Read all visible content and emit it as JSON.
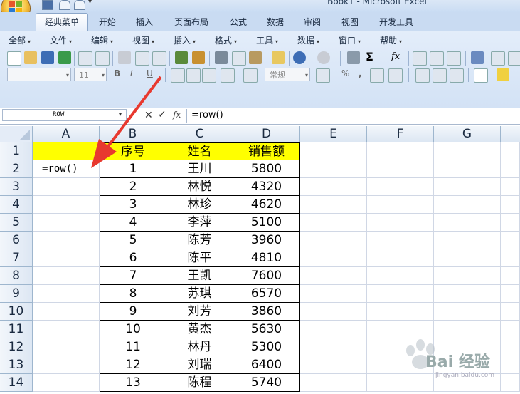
{
  "window": {
    "title": "Book1 - Microsoft Excel"
  },
  "tabs": [
    {
      "label": "经典菜单",
      "active": true
    },
    {
      "label": "开始"
    },
    {
      "label": "插入"
    },
    {
      "label": "页面布局"
    },
    {
      "label": "公式"
    },
    {
      "label": "数据"
    },
    {
      "label": "审阅"
    },
    {
      "label": "视图"
    },
    {
      "label": "开发工具"
    }
  ],
  "menu": [
    "全部",
    "文件",
    "编辑",
    "视图",
    "插入",
    "格式",
    "工具",
    "数据",
    "窗口",
    "帮助"
  ],
  "toolbar": {
    "font_size": "11",
    "number_format": "常规",
    "autosum": "Σ",
    "fx": "fx"
  },
  "formula_bar": {
    "name_box": "ROW",
    "fx_label": "fx",
    "cancel": "✕",
    "enter": "✓",
    "formula": "=row()"
  },
  "columns": [
    "A",
    "B",
    "C",
    "D",
    "E",
    "F",
    "G"
  ],
  "rows": [
    "1",
    "2",
    "3",
    "4",
    "5",
    "6",
    "7",
    "8",
    "9",
    "10",
    "11",
    "12",
    "13",
    "14"
  ],
  "sheet": {
    "a2": "=row()",
    "header": {
      "b": "序号",
      "c": "姓名",
      "d": "销售额"
    },
    "data": [
      {
        "no": "1",
        "name": "王川",
        "sales": "5800"
      },
      {
        "no": "2",
        "name": "林悦",
        "sales": "4320"
      },
      {
        "no": "3",
        "name": "林珍",
        "sales": "4620"
      },
      {
        "no": "4",
        "name": "李萍",
        "sales": "5100"
      },
      {
        "no": "5",
        "name": "陈芳",
        "sales": "3960"
      },
      {
        "no": "6",
        "name": "陈平",
        "sales": "4810"
      },
      {
        "no": "7",
        "name": "王凯",
        "sales": "7600"
      },
      {
        "no": "8",
        "name": "苏琪",
        "sales": "6570"
      },
      {
        "no": "9",
        "name": "刘芳",
        "sales": "3860"
      },
      {
        "no": "10",
        "name": "黄杰",
        "sales": "5630"
      },
      {
        "no": "11",
        "name": "林丹",
        "sales": "5300"
      },
      {
        "no": "12",
        "name": "刘瑞",
        "sales": "6400"
      },
      {
        "no": "13",
        "name": "陈程",
        "sales": "5740"
      }
    ]
  },
  "watermark": {
    "text": "Bai 经验",
    "url": "jingyan.baidu.com"
  },
  "colors": {
    "highlight": "#ffff00",
    "arrow": "#e8392f",
    "ribbon": "#d3e2f5"
  }
}
